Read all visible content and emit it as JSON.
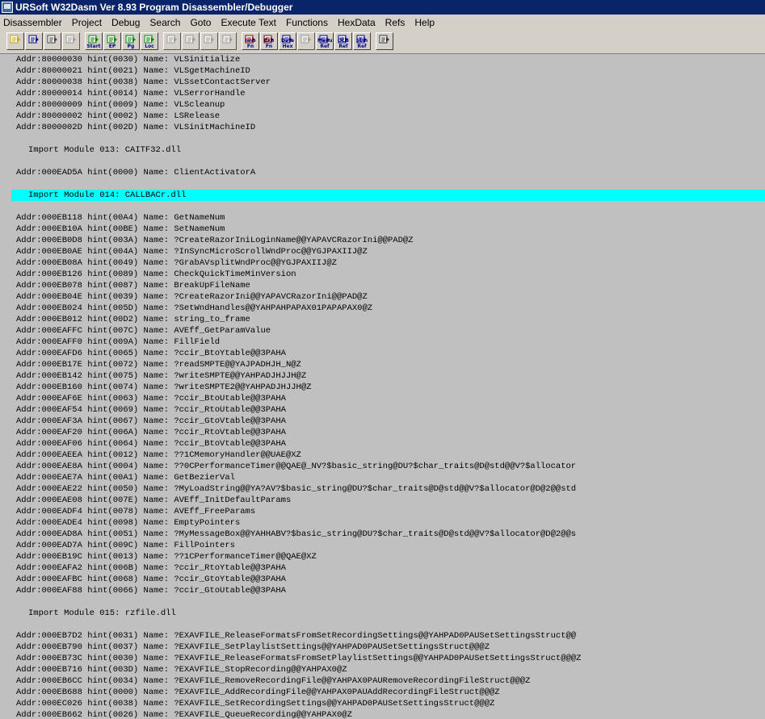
{
  "window": {
    "title": "URSoft W32Dasm Ver 8.93 Program Disassembler/Debugger",
    "icon": "disassembler-app-icon"
  },
  "menubar": [
    "Disassembler",
    "Project",
    "Debug",
    "Search",
    "Goto",
    "Execute Text",
    "Functions",
    "HexData",
    "Refs",
    "Help"
  ],
  "toolbar": [
    {
      "name": "open-file-button",
      "icon": "open-file-icon",
      "tag": "",
      "enabled": true
    },
    {
      "name": "save-file-button",
      "icon": "save-file-icon",
      "tag": "",
      "enabled": true
    },
    {
      "name": "find-text-button",
      "icon": "find-icon",
      "tag": "",
      "enabled": true
    },
    {
      "name": "copy-lines-button",
      "icon": "copy-icon",
      "tag": "",
      "enabled": false
    },
    {
      "name": "goto-code-start-button",
      "icon": "goto-icon",
      "tag": "Start",
      "enabled": true
    },
    {
      "name": "goto-entry-point-button",
      "icon": "goto-icon",
      "tag": "EP",
      "enabled": true
    },
    {
      "name": "goto-page-button",
      "icon": "goto-icon",
      "tag": "Pg",
      "enabled": true
    },
    {
      "name": "goto-location-button",
      "icon": "goto-icon",
      "tag": "Loc",
      "enabled": true
    },
    {
      "name": "jump-to-button",
      "icon": "jump-icon",
      "tag": "",
      "enabled": false
    },
    {
      "name": "return-from-jump-button",
      "icon": "jump-icon",
      "tag": "",
      "enabled": false
    },
    {
      "name": "execute-call-button",
      "icon": "call-icon",
      "tag": "",
      "enabled": false
    },
    {
      "name": "return-from-call-button",
      "icon": "call-icon",
      "tag": "",
      "enabled": false
    },
    {
      "name": "imports-button",
      "icon": "imports-icon",
      "tag": "Imp Fn",
      "enabled": true
    },
    {
      "name": "exports-button",
      "icon": "exports-icon",
      "tag": "Exp Fn",
      "enabled": true
    },
    {
      "name": "hex-data-button",
      "icon": "hex-icon",
      "tag": "Data Hex",
      "enabled": true
    },
    {
      "name": "hex-code-button",
      "icon": "hex-icon",
      "tag": "",
      "enabled": false
    },
    {
      "name": "menu-refs-button",
      "icon": "menu-ref-icon",
      "tag": "Menu Ref",
      "enabled": true
    },
    {
      "name": "dialog-refs-button",
      "icon": "dialog-ref-icon",
      "tag": "DLG Ref",
      "enabled": true
    },
    {
      "name": "string-refs-button",
      "icon": "string-ref-icon",
      "tag": "Strn Ref",
      "enabled": true
    },
    {
      "name": "print-button",
      "icon": "printer-icon",
      "tag": "",
      "enabled": true
    }
  ],
  "lines": [
    {
      "type": "entry",
      "text": "Addr:80000030 hint(0030) Name: VLSinitialize"
    },
    {
      "type": "entry",
      "text": "Addr:80000021 hint(0021) Name: VLSgetMachineID"
    },
    {
      "type": "entry",
      "text": "Addr:80000038 hint(0038) Name: VLSsetContactServer"
    },
    {
      "type": "entry",
      "text": "Addr:80000014 hint(0014) Name: VLSerrorHandle"
    },
    {
      "type": "entry",
      "text": "Addr:80000009 hint(0009) Name: VLScleanup"
    },
    {
      "type": "entry",
      "text": "Addr:80000002 hint(0002) Name: LSRelease"
    },
    {
      "type": "entry",
      "text": "Addr:8000002D hint(002D) Name: VLSinitMachineID"
    },
    {
      "type": "blank",
      "text": ""
    },
    {
      "type": "header",
      "text": "Import Module 013: CAITF32.dll"
    },
    {
      "type": "blank",
      "text": ""
    },
    {
      "type": "entry",
      "text": "Addr:000EAD5A hint(0000) Name: ClientActivatorA"
    },
    {
      "type": "blank",
      "text": ""
    },
    {
      "type": "header",
      "highlight": true,
      "text": "Import Module 014: CALLBACr.dll"
    },
    {
      "type": "blank",
      "text": ""
    },
    {
      "type": "entry",
      "text": "Addr:000EB118 hint(00A4) Name: GetNameNum"
    },
    {
      "type": "entry",
      "text": "Addr:000EB10A hint(00BE) Name: SetNameNum"
    },
    {
      "type": "entry",
      "text": "Addr:000EB0D8 hint(003A) Name: ?CreateRazorIniLoginName@@YAPAVCRazorIni@@PAD@Z"
    },
    {
      "type": "entry",
      "text": "Addr:000EB0AE hint(004A) Name: ?InSyncMicroScrollWndProc@@YGJPAXIIJ@Z"
    },
    {
      "type": "entry",
      "text": "Addr:000EB08A hint(0049) Name: ?GrabAVsplitWndProc@@YGJPAXIIJ@Z"
    },
    {
      "type": "entry",
      "text": "Addr:000EB126 hint(0089) Name: CheckQuickTimeMinVersion"
    },
    {
      "type": "entry",
      "text": "Addr:000EB078 hint(0087) Name: BreakUpFileName"
    },
    {
      "type": "entry",
      "text": "Addr:000EB04E hint(0039) Name: ?CreateRazorIni@@YAPAVCRazorIni@@PAD@Z"
    },
    {
      "type": "entry",
      "text": "Addr:000EB024 hint(005D) Name: ?SetWndHandles@@YAHPAHPAPAX01PAPAPAX0@Z"
    },
    {
      "type": "entry",
      "text": "Addr:000EB012 hint(00D2) Name: string_to_frame"
    },
    {
      "type": "entry",
      "text": "Addr:000EAFFC hint(007C) Name: AVEff_GetParamValue"
    },
    {
      "type": "entry",
      "text": "Addr:000EAFF0 hint(009A) Name: FillField"
    },
    {
      "type": "entry",
      "text": "Addr:000EAFD6 hint(0065) Name: ?ccir_BtoYtable@@3PAHA"
    },
    {
      "type": "entry",
      "text": "Addr:000EB17E hint(0072) Name: ?readSMPTE@@YAJPADHJH_N@Z"
    },
    {
      "type": "entry",
      "text": "Addr:000EB142 hint(0075) Name: ?writeSMPTE@@YAHPADJHJJH@Z"
    },
    {
      "type": "entry",
      "text": "Addr:000EB160 hint(0074) Name: ?writeSMPTE2@@YAHPADJHJJH@Z"
    },
    {
      "type": "entry",
      "text": "Addr:000EAF6E hint(0063) Name: ?ccir_BtoUtable@@3PAHA"
    },
    {
      "type": "entry",
      "text": "Addr:000EAF54 hint(0069) Name: ?ccir_RtoUtable@@3PAHA"
    },
    {
      "type": "entry",
      "text": "Addr:000EAF3A hint(0067) Name: ?ccir_GtoVtable@@3PAHA"
    },
    {
      "type": "entry",
      "text": "Addr:000EAF20 hint(006A) Name: ?ccir_RtoVtable@@3PAHA"
    },
    {
      "type": "entry",
      "text": "Addr:000EAF06 hint(0064) Name: ?ccir_BtoVtable@@3PAHA"
    },
    {
      "type": "entry",
      "text": "Addr:000EAEEA hint(0012) Name: ??1CMemoryHandler@@UAE@XZ"
    },
    {
      "type": "entry",
      "text": "Addr:000EAE8A hint(0004) Name: ??0CPerformanceTimer@@QAE@_NV?$basic_string@DU?$char_traits@D@std@@V?$allocator"
    },
    {
      "type": "entry",
      "text": "Addr:000EAE7A hint(00A1) Name: GetBezierVal"
    },
    {
      "type": "entry",
      "text": "Addr:000EAE22 hint(0050) Name: ?MyLoadString@@YA?AV?$basic_string@DU?$char_traits@D@std@@V?$allocator@D@2@@std"
    },
    {
      "type": "entry",
      "text": "Addr:000EAE08 hint(007E) Name: AVEff_InitDefaultParams"
    },
    {
      "type": "entry",
      "text": "Addr:000EADF4 hint(0078) Name: AVEff_FreeParams"
    },
    {
      "type": "entry",
      "text": "Addr:000EADE4 hint(0098) Name: EmptyPointers"
    },
    {
      "type": "entry",
      "text": "Addr:000EAD8A hint(0051) Name: ?MyMessageBox@@YAHHABV?$basic_string@DU?$char_traits@D@std@@V?$allocator@D@2@@s"
    },
    {
      "type": "entry",
      "text": "Addr:000EAD7A hint(009C) Name: FillPointers"
    },
    {
      "type": "entry",
      "text": "Addr:000EB19C hint(0013) Name: ??1CPerformanceTimer@@QAE@XZ"
    },
    {
      "type": "entry",
      "text": "Addr:000EAFA2 hint(006B) Name: ?ccir_RtoYtable@@3PAHA"
    },
    {
      "type": "entry",
      "text": "Addr:000EAFBC hint(0068) Name: ?ccir_GtoYtable@@3PAHA"
    },
    {
      "type": "entry",
      "text": "Addr:000EAF88 hint(0066) Name: ?ccir_GtoUtable@@3PAHA"
    },
    {
      "type": "blank",
      "text": ""
    },
    {
      "type": "header",
      "text": "Import Module 015: rzfile.dll"
    },
    {
      "type": "blank",
      "text": ""
    },
    {
      "type": "entry",
      "text": "Addr:000EB7D2 hint(0031) Name: ?EXAVFILE_ReleaseFormatsFromSetRecordingSettings@@YAHPAD0PAUSetSettingsStruct@@"
    },
    {
      "type": "entry",
      "text": "Addr:000EB790 hint(0037) Name: ?EXAVFILE_SetPlaylistSettings@@YAHPAD0PAUSetSettingsStruct@@@Z"
    },
    {
      "type": "entry",
      "text": "Addr:000EB73C hint(0030) Name: ?EXAVFILE_ReleaseFormatsFromSetPlaylistSettings@@YAHPAD0PAUSetSettingsStruct@@@Z"
    },
    {
      "type": "entry",
      "text": "Addr:000EB716 hint(003D) Name: ?EXAVFILE_StopRecording@@YAHPAX0@Z"
    },
    {
      "type": "entry",
      "text": "Addr:000EB6CC hint(0034) Name: ?EXAVFILE_RemoveRecordingFile@@YAHPAX0PAURemoveRecordingFileStruct@@@Z"
    },
    {
      "type": "entry",
      "text": "Addr:000EB688 hint(0000) Name: ?EXAVFILE_AddRecordingFile@@YAHPAX0PAUAddRecordingFileStruct@@@Z"
    },
    {
      "type": "entry",
      "text": "Addr:000EC026 hint(0038) Name: ?EXAVFILE_SetRecordingSettings@@YAHPAD0PAUSetSettingsStruct@@@Z"
    },
    {
      "type": "entry",
      "text": "Addr:000EB662 hint(0026) Name: ?EXAVFILE_QueueRecording@@YAHPAX0@Z"
    }
  ]
}
